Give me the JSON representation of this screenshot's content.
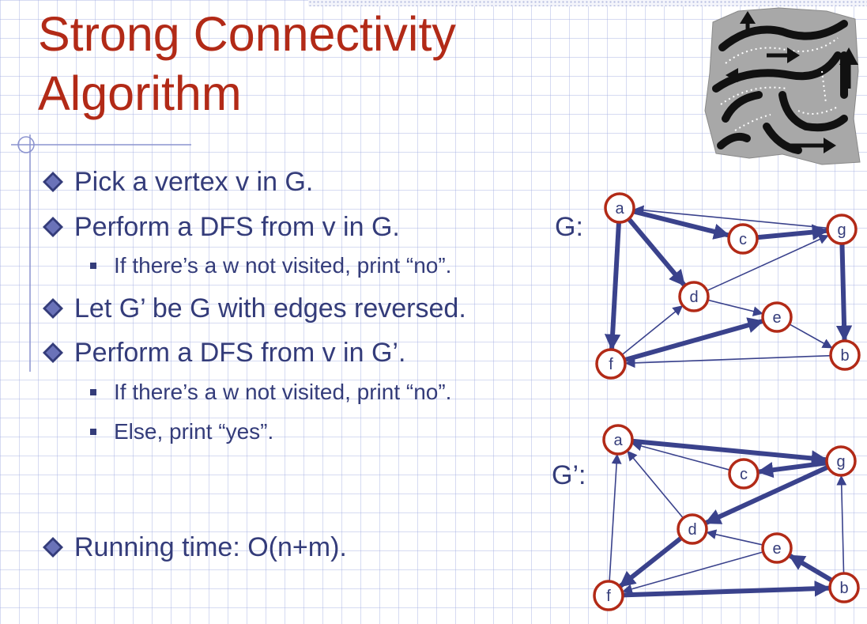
{
  "slide": {
    "title_lines": [
      "Strong Connectivity",
      "Algorithm"
    ],
    "bullets": [
      {
        "level": 1,
        "text": "Pick a vertex v in G."
      },
      {
        "level": 1,
        "text": "Perform a DFS from v in G."
      },
      {
        "level": 2,
        "text": "If there’s a w not visited, print “no”."
      },
      {
        "level": 1,
        "text": "Let G’ be G with edges reversed."
      },
      {
        "level": 1,
        "text": "Perform a DFS from v in G’."
      },
      {
        "level": 2,
        "text": "If there’s a w not visited, print “no”."
      },
      {
        "level": 2,
        "text": "Else, print “yes”."
      },
      {
        "level": 1,
        "text": "Running time: O(n+m)."
      }
    ]
  },
  "graphs": [
    {
      "label": "G:",
      "nodes": [
        "a",
        "c",
        "g",
        "d",
        "e",
        "f",
        "b"
      ],
      "edges": [
        {
          "from": "a",
          "to": "c",
          "bold": true
        },
        {
          "from": "c",
          "to": "g",
          "bold": true
        },
        {
          "from": "g",
          "to": "a",
          "bold": false
        },
        {
          "from": "a",
          "to": "d",
          "bold": true
        },
        {
          "from": "a",
          "to": "f",
          "bold": true
        },
        {
          "from": "g",
          "to": "b",
          "bold": true
        },
        {
          "from": "d",
          "to": "g",
          "bold": false
        },
        {
          "from": "d",
          "to": "e",
          "bold": false
        },
        {
          "from": "f",
          "to": "d",
          "bold": false
        },
        {
          "from": "f",
          "to": "e",
          "bold": true
        },
        {
          "from": "e",
          "to": "b",
          "bold": false
        },
        {
          "from": "b",
          "to": "f",
          "bold": false
        }
      ]
    },
    {
      "label": "G’:",
      "nodes": [
        "a",
        "g",
        "c",
        "d",
        "e",
        "f",
        "b"
      ],
      "edges": [
        {
          "from": "a",
          "to": "g",
          "bold": true
        },
        {
          "from": "g",
          "to": "c",
          "bold": true
        },
        {
          "from": "c",
          "to": "a",
          "bold": false
        },
        {
          "from": "g",
          "to": "d",
          "bold": true
        },
        {
          "from": "d",
          "to": "a",
          "bold": false
        },
        {
          "from": "d",
          "to": "f",
          "bold": true
        },
        {
          "from": "f",
          "to": "a",
          "bold": false
        },
        {
          "from": "e",
          "to": "d",
          "bold": false
        },
        {
          "from": "b",
          "to": "e",
          "bold": true
        },
        {
          "from": "e",
          "to": "f",
          "bold": false
        },
        {
          "from": "f",
          "to": "b",
          "bold": true
        },
        {
          "from": "b",
          "to": "g",
          "bold": false
        }
      ]
    }
  ],
  "colors": {
    "title": "#b22a17",
    "text": "#343c7a",
    "node_stroke": "#b22a17",
    "edge": "#3a428c"
  },
  "illustration": {
    "icon": "maze-arrows-icon"
  }
}
